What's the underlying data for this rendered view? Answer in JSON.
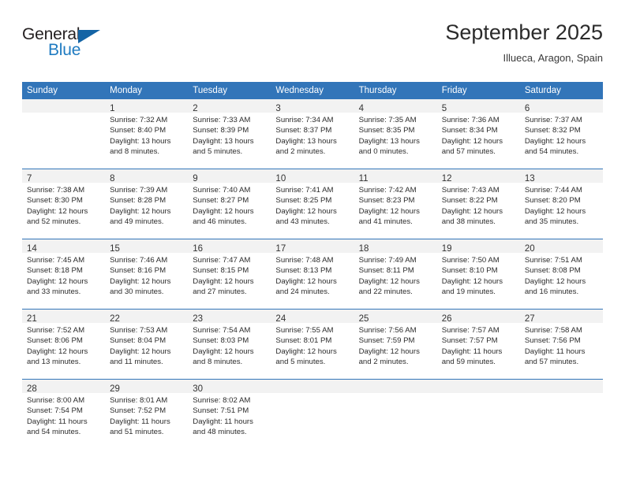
{
  "brand": {
    "name_part1": "General",
    "name_part2": "Blue",
    "accent_color": "#1464a5",
    "text_color": "#231f20",
    "blue_text_color": "#1f7bc1",
    "logo_icon": "triangle-flag-icon"
  },
  "header": {
    "month_title": "September 2025",
    "location": "Illueca, Aragon, Spain"
  },
  "theme": {
    "header_bg": "#3275b9",
    "header_text": "#ffffff",
    "daynum_band_bg": "#f2f2f2",
    "row_divider": "#3275b9",
    "body_text": "#2c2c2c"
  },
  "calendar": {
    "weekday_headers": [
      "Sunday",
      "Monday",
      "Tuesday",
      "Wednesday",
      "Thursday",
      "Friday",
      "Saturday"
    ],
    "weeks": [
      [
        {
          "day": "",
          "lines": []
        },
        {
          "day": "1",
          "lines": [
            "Sunrise: 7:32 AM",
            "Sunset: 8:40 PM",
            "Daylight: 13 hours",
            "and 8 minutes."
          ]
        },
        {
          "day": "2",
          "lines": [
            "Sunrise: 7:33 AM",
            "Sunset: 8:39 PM",
            "Daylight: 13 hours",
            "and 5 minutes."
          ]
        },
        {
          "day": "3",
          "lines": [
            "Sunrise: 7:34 AM",
            "Sunset: 8:37 PM",
            "Daylight: 13 hours",
            "and 2 minutes."
          ]
        },
        {
          "day": "4",
          "lines": [
            "Sunrise: 7:35 AM",
            "Sunset: 8:35 PM",
            "Daylight: 13 hours",
            "and 0 minutes."
          ]
        },
        {
          "day": "5",
          "lines": [
            "Sunrise: 7:36 AM",
            "Sunset: 8:34 PM",
            "Daylight: 12 hours",
            "and 57 minutes."
          ]
        },
        {
          "day": "6",
          "lines": [
            "Sunrise: 7:37 AM",
            "Sunset: 8:32 PM",
            "Daylight: 12 hours",
            "and 54 minutes."
          ]
        }
      ],
      [
        {
          "day": "7",
          "lines": [
            "Sunrise: 7:38 AM",
            "Sunset: 8:30 PM",
            "Daylight: 12 hours",
            "and 52 minutes."
          ]
        },
        {
          "day": "8",
          "lines": [
            "Sunrise: 7:39 AM",
            "Sunset: 8:28 PM",
            "Daylight: 12 hours",
            "and 49 minutes."
          ]
        },
        {
          "day": "9",
          "lines": [
            "Sunrise: 7:40 AM",
            "Sunset: 8:27 PM",
            "Daylight: 12 hours",
            "and 46 minutes."
          ]
        },
        {
          "day": "10",
          "lines": [
            "Sunrise: 7:41 AM",
            "Sunset: 8:25 PM",
            "Daylight: 12 hours",
            "and 43 minutes."
          ]
        },
        {
          "day": "11",
          "lines": [
            "Sunrise: 7:42 AM",
            "Sunset: 8:23 PM",
            "Daylight: 12 hours",
            "and 41 minutes."
          ]
        },
        {
          "day": "12",
          "lines": [
            "Sunrise: 7:43 AM",
            "Sunset: 8:22 PM",
            "Daylight: 12 hours",
            "and 38 minutes."
          ]
        },
        {
          "day": "13",
          "lines": [
            "Sunrise: 7:44 AM",
            "Sunset: 8:20 PM",
            "Daylight: 12 hours",
            "and 35 minutes."
          ]
        }
      ],
      [
        {
          "day": "14",
          "lines": [
            "Sunrise: 7:45 AM",
            "Sunset: 8:18 PM",
            "Daylight: 12 hours",
            "and 33 minutes."
          ]
        },
        {
          "day": "15",
          "lines": [
            "Sunrise: 7:46 AM",
            "Sunset: 8:16 PM",
            "Daylight: 12 hours",
            "and 30 minutes."
          ]
        },
        {
          "day": "16",
          "lines": [
            "Sunrise: 7:47 AM",
            "Sunset: 8:15 PM",
            "Daylight: 12 hours",
            "and 27 minutes."
          ]
        },
        {
          "day": "17",
          "lines": [
            "Sunrise: 7:48 AM",
            "Sunset: 8:13 PM",
            "Daylight: 12 hours",
            "and 24 minutes."
          ]
        },
        {
          "day": "18",
          "lines": [
            "Sunrise: 7:49 AM",
            "Sunset: 8:11 PM",
            "Daylight: 12 hours",
            "and 22 minutes."
          ]
        },
        {
          "day": "19",
          "lines": [
            "Sunrise: 7:50 AM",
            "Sunset: 8:10 PM",
            "Daylight: 12 hours",
            "and 19 minutes."
          ]
        },
        {
          "day": "20",
          "lines": [
            "Sunrise: 7:51 AM",
            "Sunset: 8:08 PM",
            "Daylight: 12 hours",
            "and 16 minutes."
          ]
        }
      ],
      [
        {
          "day": "21",
          "lines": [
            "Sunrise: 7:52 AM",
            "Sunset: 8:06 PM",
            "Daylight: 12 hours",
            "and 13 minutes."
          ]
        },
        {
          "day": "22",
          "lines": [
            "Sunrise: 7:53 AM",
            "Sunset: 8:04 PM",
            "Daylight: 12 hours",
            "and 11 minutes."
          ]
        },
        {
          "day": "23",
          "lines": [
            "Sunrise: 7:54 AM",
            "Sunset: 8:03 PM",
            "Daylight: 12 hours",
            "and 8 minutes."
          ]
        },
        {
          "day": "24",
          "lines": [
            "Sunrise: 7:55 AM",
            "Sunset: 8:01 PM",
            "Daylight: 12 hours",
            "and 5 minutes."
          ]
        },
        {
          "day": "25",
          "lines": [
            "Sunrise: 7:56 AM",
            "Sunset: 7:59 PM",
            "Daylight: 12 hours",
            "and 2 minutes."
          ]
        },
        {
          "day": "26",
          "lines": [
            "Sunrise: 7:57 AM",
            "Sunset: 7:57 PM",
            "Daylight: 11 hours",
            "and 59 minutes."
          ]
        },
        {
          "day": "27",
          "lines": [
            "Sunrise: 7:58 AM",
            "Sunset: 7:56 PM",
            "Daylight: 11 hours",
            "and 57 minutes."
          ]
        }
      ],
      [
        {
          "day": "28",
          "lines": [
            "Sunrise: 8:00 AM",
            "Sunset: 7:54 PM",
            "Daylight: 11 hours",
            "and 54 minutes."
          ]
        },
        {
          "day": "29",
          "lines": [
            "Sunrise: 8:01 AM",
            "Sunset: 7:52 PM",
            "Daylight: 11 hours",
            "and 51 minutes."
          ]
        },
        {
          "day": "30",
          "lines": [
            "Sunrise: 8:02 AM",
            "Sunset: 7:51 PM",
            "Daylight: 11 hours",
            "and 48 minutes."
          ]
        },
        {
          "day": "",
          "lines": []
        },
        {
          "day": "",
          "lines": []
        },
        {
          "day": "",
          "lines": []
        },
        {
          "day": "",
          "lines": []
        }
      ]
    ]
  }
}
